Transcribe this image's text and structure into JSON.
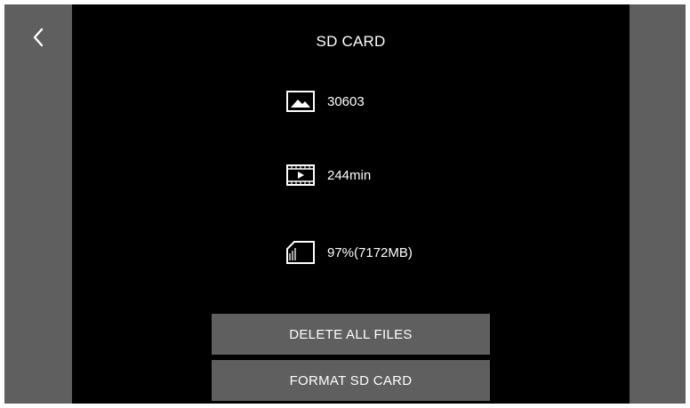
{
  "header": {
    "title": "SD CARD",
    "back_icon": "chevron-left-icon"
  },
  "stats": {
    "photos": {
      "icon": "image-icon",
      "value": "30603"
    },
    "video": {
      "icon": "film-icon",
      "value": "244min"
    },
    "storage": {
      "icon": "sd-card-icon",
      "value": "97%(7172MB)"
    }
  },
  "actions": {
    "delete_label": "DELETE ALL FILES",
    "format_label": "FORMAT SD CARD"
  },
  "colors": {
    "background": "#000000",
    "panel": "#5f5f5f",
    "text": "#ffffff"
  }
}
